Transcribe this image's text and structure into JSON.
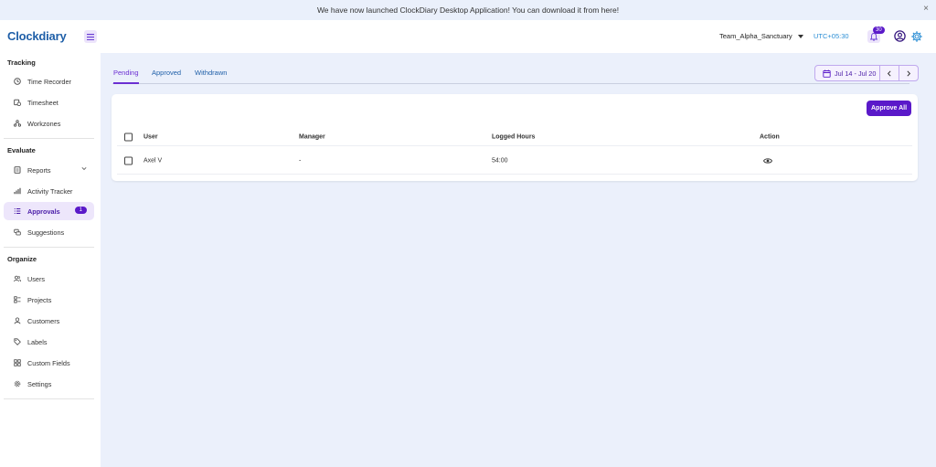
{
  "banner": {
    "text": "We have now launched ClockDiary Desktop Application! You can download it from here!",
    "close": "×"
  },
  "header": {
    "logo": "Clockdiary",
    "team": "Team_Alpha_Sanctuary",
    "timezone": "UTC+05:30",
    "notifications_count": "30"
  },
  "sidebar": {
    "sections": [
      {
        "title": "Tracking"
      },
      {
        "title": "Evaluate"
      },
      {
        "title": "Organize"
      }
    ],
    "items": [
      {
        "label": "Time Recorder",
        "icon": "clock-icon"
      },
      {
        "label": "Timesheet",
        "icon": "timesheet-icon"
      },
      {
        "label": "Workzones",
        "icon": "workzones-icon"
      },
      {
        "label": "Reports",
        "icon": "reports-icon"
      },
      {
        "label": "Activity Tracker",
        "icon": "bar-chart-icon"
      },
      {
        "label": "Approvals",
        "icon": "checklist-icon",
        "badge": "1"
      },
      {
        "label": "Suggestions",
        "icon": "suggestions-icon"
      },
      {
        "label": "Users",
        "icon": "users-icon"
      },
      {
        "label": "Projects",
        "icon": "projects-icon"
      },
      {
        "label": "Customers",
        "icon": "customer-icon"
      },
      {
        "label": "Labels",
        "icon": "tag-icon"
      },
      {
        "label": "Custom Fields",
        "icon": "custom-fields-icon"
      },
      {
        "label": "Settings",
        "icon": "gear-icon"
      }
    ]
  },
  "tabs": [
    {
      "label": "Pending",
      "active": true
    },
    {
      "label": "Approved"
    },
    {
      "label": "Withdrawn"
    }
  ],
  "date_range": "Jul 14 - Jul 20",
  "table": {
    "approve_all": "Approve All",
    "columns": [
      "User",
      "Manager",
      "Logged Hours",
      "Action"
    ],
    "rows": [
      {
        "user": "Axel V",
        "manager": "-",
        "logged_hours": "54:00",
        "action": "eye-icon"
      }
    ]
  },
  "colors": {
    "accent": "#5a19c9",
    "link": "#1f5fa8",
    "content_bg": "#ebf0fb"
  }
}
